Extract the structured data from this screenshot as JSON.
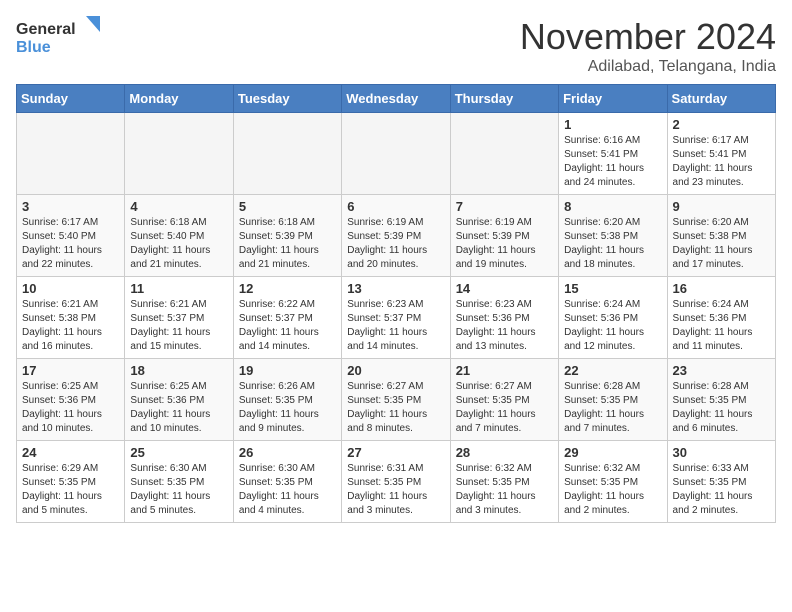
{
  "logo": {
    "text_general": "General",
    "text_blue": "Blue"
  },
  "header": {
    "month": "November 2024",
    "location": "Adilabad, Telangana, India"
  },
  "weekdays": [
    "Sunday",
    "Monday",
    "Tuesday",
    "Wednesday",
    "Thursday",
    "Friday",
    "Saturday"
  ],
  "weeks": [
    [
      {
        "day": "",
        "empty": true
      },
      {
        "day": "",
        "empty": true
      },
      {
        "day": "",
        "empty": true
      },
      {
        "day": "",
        "empty": true
      },
      {
        "day": "",
        "empty": true
      },
      {
        "day": "1",
        "sunrise": "6:16 AM",
        "sunset": "5:41 PM",
        "daylight": "11 hours and 24 minutes."
      },
      {
        "day": "2",
        "sunrise": "6:17 AM",
        "sunset": "5:41 PM",
        "daylight": "11 hours and 23 minutes."
      }
    ],
    [
      {
        "day": "3",
        "sunrise": "6:17 AM",
        "sunset": "5:40 PM",
        "daylight": "11 hours and 22 minutes."
      },
      {
        "day": "4",
        "sunrise": "6:18 AM",
        "sunset": "5:40 PM",
        "daylight": "11 hours and 21 minutes."
      },
      {
        "day": "5",
        "sunrise": "6:18 AM",
        "sunset": "5:39 PM",
        "daylight": "11 hours and 21 minutes."
      },
      {
        "day": "6",
        "sunrise": "6:19 AM",
        "sunset": "5:39 PM",
        "daylight": "11 hours and 20 minutes."
      },
      {
        "day": "7",
        "sunrise": "6:19 AM",
        "sunset": "5:39 PM",
        "daylight": "11 hours and 19 minutes."
      },
      {
        "day": "8",
        "sunrise": "6:20 AM",
        "sunset": "5:38 PM",
        "daylight": "11 hours and 18 minutes."
      },
      {
        "day": "9",
        "sunrise": "6:20 AM",
        "sunset": "5:38 PM",
        "daylight": "11 hours and 17 minutes."
      }
    ],
    [
      {
        "day": "10",
        "sunrise": "6:21 AM",
        "sunset": "5:38 PM",
        "daylight": "11 hours and 16 minutes."
      },
      {
        "day": "11",
        "sunrise": "6:21 AM",
        "sunset": "5:37 PM",
        "daylight": "11 hours and 15 minutes."
      },
      {
        "day": "12",
        "sunrise": "6:22 AM",
        "sunset": "5:37 PM",
        "daylight": "11 hours and 14 minutes."
      },
      {
        "day": "13",
        "sunrise": "6:23 AM",
        "sunset": "5:37 PM",
        "daylight": "11 hours and 14 minutes."
      },
      {
        "day": "14",
        "sunrise": "6:23 AM",
        "sunset": "5:36 PM",
        "daylight": "11 hours and 13 minutes."
      },
      {
        "day": "15",
        "sunrise": "6:24 AM",
        "sunset": "5:36 PM",
        "daylight": "11 hours and 12 minutes."
      },
      {
        "day": "16",
        "sunrise": "6:24 AM",
        "sunset": "5:36 PM",
        "daylight": "11 hours and 11 minutes."
      }
    ],
    [
      {
        "day": "17",
        "sunrise": "6:25 AM",
        "sunset": "5:36 PM",
        "daylight": "11 hours and 10 minutes."
      },
      {
        "day": "18",
        "sunrise": "6:25 AM",
        "sunset": "5:36 PM",
        "daylight": "11 hours and 10 minutes."
      },
      {
        "day": "19",
        "sunrise": "6:26 AM",
        "sunset": "5:35 PM",
        "daylight": "11 hours and 9 minutes."
      },
      {
        "day": "20",
        "sunrise": "6:27 AM",
        "sunset": "5:35 PM",
        "daylight": "11 hours and 8 minutes."
      },
      {
        "day": "21",
        "sunrise": "6:27 AM",
        "sunset": "5:35 PM",
        "daylight": "11 hours and 7 minutes."
      },
      {
        "day": "22",
        "sunrise": "6:28 AM",
        "sunset": "5:35 PM",
        "daylight": "11 hours and 7 minutes."
      },
      {
        "day": "23",
        "sunrise": "6:28 AM",
        "sunset": "5:35 PM",
        "daylight": "11 hours and 6 minutes."
      }
    ],
    [
      {
        "day": "24",
        "sunrise": "6:29 AM",
        "sunset": "5:35 PM",
        "daylight": "11 hours and 5 minutes."
      },
      {
        "day": "25",
        "sunrise": "6:30 AM",
        "sunset": "5:35 PM",
        "daylight": "11 hours and 5 minutes."
      },
      {
        "day": "26",
        "sunrise": "6:30 AM",
        "sunset": "5:35 PM",
        "daylight": "11 hours and 4 minutes."
      },
      {
        "day": "27",
        "sunrise": "6:31 AM",
        "sunset": "5:35 PM",
        "daylight": "11 hours and 3 minutes."
      },
      {
        "day": "28",
        "sunrise": "6:32 AM",
        "sunset": "5:35 PM",
        "daylight": "11 hours and 3 minutes."
      },
      {
        "day": "29",
        "sunrise": "6:32 AM",
        "sunset": "5:35 PM",
        "daylight": "11 hours and 2 minutes."
      },
      {
        "day": "30",
        "sunrise": "6:33 AM",
        "sunset": "5:35 PM",
        "daylight": "11 hours and 2 minutes."
      }
    ]
  ]
}
